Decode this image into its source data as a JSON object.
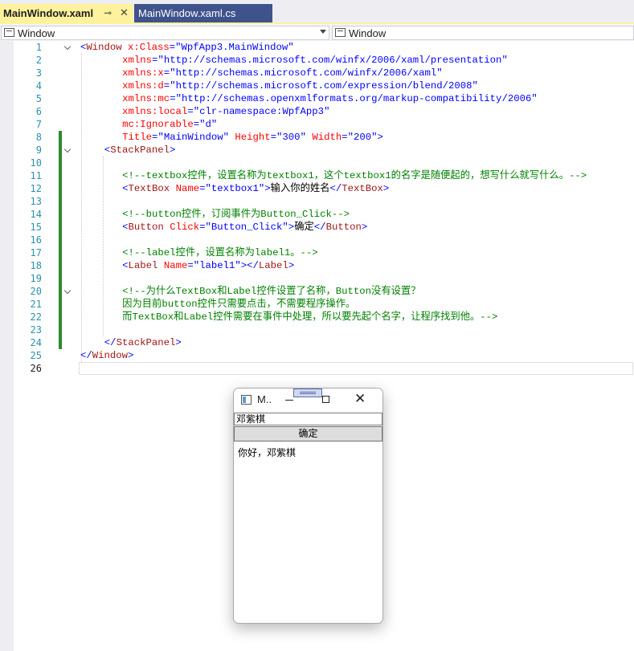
{
  "tabs": {
    "active": {
      "label": "MainWindow.xaml",
      "pin_glyph": "⊸",
      "close_glyph": "✕"
    },
    "inactive": {
      "label": "MainWindow.xaml.cs"
    }
  },
  "navbar": {
    "left_scope": "Window",
    "right_scope": "Window"
  },
  "editor": {
    "current_line": 26,
    "lines": [
      {
        "n": 1,
        "indent": 0,
        "tokens": [
          [
            "p",
            "<"
          ],
          [
            "t",
            "Window"
          ],
          [
            "a",
            " x:Class"
          ],
          [
            "p",
            "="
          ],
          [
            "v",
            "\"WpfApp3.MainWindow\""
          ]
        ]
      },
      {
        "n": 2,
        "indent": 7,
        "tokens": [
          [
            "a",
            "xmlns"
          ],
          [
            "p",
            "="
          ],
          [
            "v",
            "\"http://schemas.microsoft.com/winfx/2006/xaml/presentation\""
          ]
        ]
      },
      {
        "n": 3,
        "indent": 7,
        "tokens": [
          [
            "a",
            "xmlns:x"
          ],
          [
            "p",
            "="
          ],
          [
            "v",
            "\"http://schemas.microsoft.com/winfx/2006/xaml\""
          ]
        ]
      },
      {
        "n": 4,
        "indent": 7,
        "tokens": [
          [
            "a",
            "xmlns:d"
          ],
          [
            "p",
            "="
          ],
          [
            "v",
            "\"http://schemas.microsoft.com/expression/blend/2008\""
          ]
        ]
      },
      {
        "n": 5,
        "indent": 7,
        "tokens": [
          [
            "a",
            "xmlns:mc"
          ],
          [
            "p",
            "="
          ],
          [
            "v",
            "\"http://schemas.openxmlformats.org/markup-compatibility/2006\""
          ]
        ]
      },
      {
        "n": 6,
        "indent": 7,
        "tokens": [
          [
            "a",
            "xmlns:local"
          ],
          [
            "p",
            "="
          ],
          [
            "v",
            "\"clr-namespace:WpfApp3\""
          ]
        ]
      },
      {
        "n": 7,
        "indent": 7,
        "tokens": [
          [
            "a",
            "mc:Ignorable"
          ],
          [
            "p",
            "="
          ],
          [
            "v",
            "\"d\""
          ]
        ]
      },
      {
        "n": 8,
        "indent": 7,
        "tokens": [
          [
            "a",
            "Title"
          ],
          [
            "p",
            "="
          ],
          [
            "v",
            "\"MainWindow\""
          ],
          [
            "a",
            " Height"
          ],
          [
            "p",
            "="
          ],
          [
            "v",
            "\"300\""
          ],
          [
            "a",
            " Width"
          ],
          [
            "p",
            "="
          ],
          [
            "v",
            "\"200\""
          ],
          [
            "p",
            ">"
          ]
        ]
      },
      {
        "n": 9,
        "indent": 4,
        "tokens": [
          [
            "p",
            "<"
          ],
          [
            "t",
            "StackPanel"
          ],
          [
            "p",
            ">"
          ]
        ]
      },
      {
        "n": 10,
        "indent": 0,
        "tokens": []
      },
      {
        "n": 11,
        "indent": 7,
        "tokens": [
          [
            "c",
            "<!--textbox控件，设置名称为textbox1，这个textbox1的名字是随便起的，想写什么就写什么。-->"
          ]
        ]
      },
      {
        "n": 12,
        "indent": 7,
        "tokens": [
          [
            "p",
            "<"
          ],
          [
            "t",
            "TextBox"
          ],
          [
            "a",
            " Name"
          ],
          [
            "p",
            "="
          ],
          [
            "v",
            "\"textbox1\""
          ],
          [
            "p",
            ">"
          ],
          [
            "x",
            "输入你的姓名"
          ],
          [
            "p",
            "</"
          ],
          [
            "t",
            "TextBox"
          ],
          [
            "p",
            ">"
          ]
        ]
      },
      {
        "n": 13,
        "indent": 0,
        "tokens": []
      },
      {
        "n": 14,
        "indent": 7,
        "tokens": [
          [
            "c",
            "<!--button控件，订阅事件为Button_Click-->"
          ]
        ]
      },
      {
        "n": 15,
        "indent": 7,
        "tokens": [
          [
            "p",
            "<"
          ],
          [
            "t",
            "Button"
          ],
          [
            "a",
            " Click"
          ],
          [
            "p",
            "="
          ],
          [
            "v",
            "\"Button_Click\""
          ],
          [
            "p",
            ">"
          ],
          [
            "x",
            "确定"
          ],
          [
            "p",
            "</"
          ],
          [
            "t",
            "Button"
          ],
          [
            "p",
            ">"
          ]
        ]
      },
      {
        "n": 16,
        "indent": 0,
        "tokens": []
      },
      {
        "n": 17,
        "indent": 7,
        "tokens": [
          [
            "c",
            "<!--label控件，设置名称为label1。-->"
          ]
        ]
      },
      {
        "n": 18,
        "indent": 7,
        "tokens": [
          [
            "p",
            "<"
          ],
          [
            "t",
            "Label"
          ],
          [
            "a",
            " Name"
          ],
          [
            "p",
            "="
          ],
          [
            "v",
            "\"label1\""
          ],
          [
            "p",
            "></"
          ],
          [
            "t",
            "Label"
          ],
          [
            "p",
            ">"
          ]
        ]
      },
      {
        "n": 19,
        "indent": 0,
        "tokens": []
      },
      {
        "n": 20,
        "indent": 7,
        "tokens": [
          [
            "c",
            "<!--为什么TextBox和Label控件设置了名称，Button没有设置？"
          ]
        ]
      },
      {
        "n": 21,
        "indent": 7,
        "tokens": [
          [
            "c",
            "因为目前button控件只需要点击，不需要程序操作。"
          ]
        ]
      },
      {
        "n": 22,
        "indent": 7,
        "tokens": [
          [
            "c",
            "而TextBox和Label控件需要在事件中处理，所以要先起个名字，让程序找到他。-->"
          ]
        ]
      },
      {
        "n": 23,
        "indent": 0,
        "tokens": []
      },
      {
        "n": 24,
        "indent": 4,
        "tokens": [
          [
            "p",
            "</"
          ],
          [
            "t",
            "StackPanel"
          ],
          [
            "p",
            ">"
          ]
        ]
      },
      {
        "n": 25,
        "indent": 0,
        "tokens": [
          [
            "p",
            "</"
          ],
          [
            "t",
            "Window"
          ],
          [
            "p",
            ">"
          ]
        ]
      },
      {
        "n": 26,
        "indent": 0,
        "tokens": []
      }
    ]
  },
  "running_window": {
    "title": "M..",
    "close_glyph": "✕",
    "textbox_value": "邓紫棋",
    "button_label": "确定",
    "label_text": "你好，邓紫棋"
  }
}
